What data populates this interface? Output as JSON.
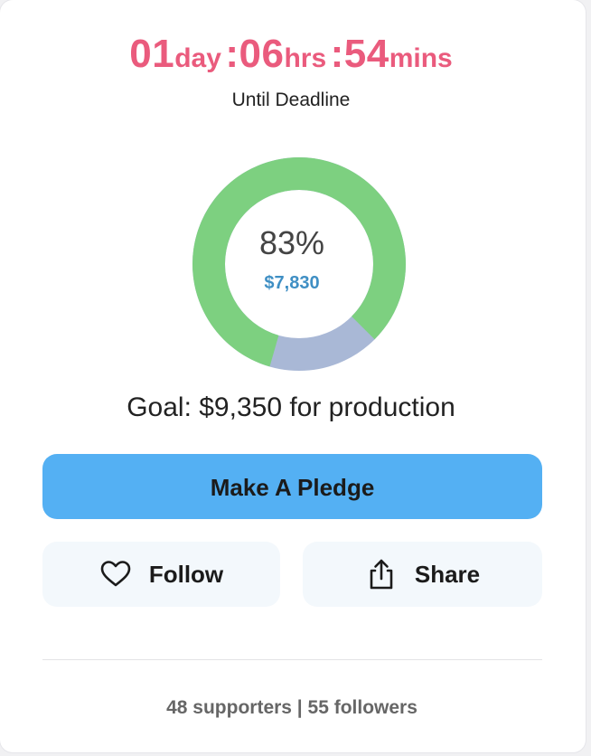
{
  "countdown": {
    "days": "01",
    "days_unit": "day",
    "hours": ":06",
    "hours_unit": "hrs",
    "minutes": ":54",
    "minutes_unit": "mins",
    "caption": "Until Deadline"
  },
  "progress": {
    "percent_label": "83%",
    "percent_value": 0.83,
    "raised": "$7,830",
    "funded_color": "#7dd080",
    "remaining_color": "#a9b8d6"
  },
  "goal": {
    "text": "Goal: $9,350 for production"
  },
  "actions": {
    "pledge_label": "Make A Pledge",
    "follow_label": "Follow",
    "follow_icon": "heart-icon",
    "share_label": "Share",
    "share_icon": "share-upload-icon"
  },
  "stats": {
    "text": "48 supporters | 55 followers"
  },
  "colors": {
    "accent_pink": "#ea5b7d",
    "button_blue": "#54b0f3",
    "raised_blue": "#3f8fc4"
  }
}
